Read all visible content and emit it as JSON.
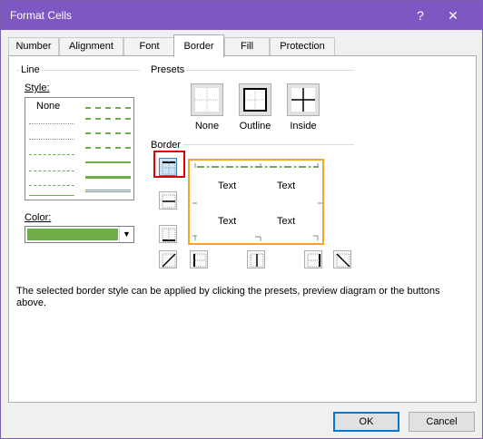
{
  "window": {
    "title": "Format Cells",
    "help": "?",
    "close": "✕"
  },
  "tabs": [
    {
      "label": "Number"
    },
    {
      "label": "Alignment"
    },
    {
      "label": "Font"
    },
    {
      "label": "Border",
      "active": true
    },
    {
      "label": "Fill"
    },
    {
      "label": "Protection"
    }
  ],
  "line": {
    "group_label": "Line",
    "style_label": "Style:",
    "style_none": "None",
    "color_label": "Color:",
    "color_value": "#70ad47"
  },
  "presets": {
    "group_label": "Presets",
    "items": [
      {
        "label": "None"
      },
      {
        "label": "Outline"
      },
      {
        "label": "Inside"
      }
    ]
  },
  "border": {
    "group_label": "Border",
    "preview_text": [
      "Text",
      "Text",
      "Text",
      "Text"
    ]
  },
  "info_text": "The selected border style can be applied by clicking the presets, preview diagram or the buttons above.",
  "buttons": {
    "ok": "OK",
    "cancel": "Cancel"
  },
  "colors": {
    "title_bar": "#7e57c2",
    "line_color": "#70ad47",
    "highlight_orange": "#f5a623",
    "highlight_red": "#e00000",
    "ok_border": "#0078d7"
  }
}
